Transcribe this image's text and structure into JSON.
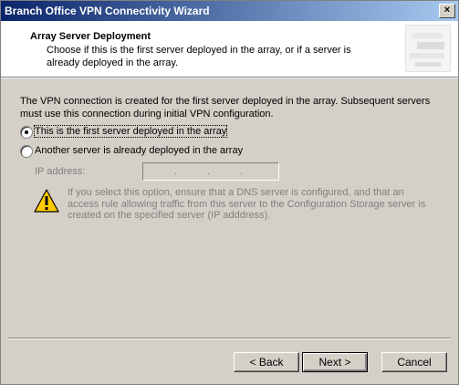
{
  "window": {
    "title": "Branch Office VPN Connectivity Wizard",
    "close_glyph": "×"
  },
  "header": {
    "title": "Array Server Deployment",
    "subtitle": "Choose if this is the first server deployed in the array, or if a server is already deployed in the array."
  },
  "intro": "The VPN connection is created for the first server deployed in the array. Subsequent servers must use this connection during initial VPN configuration.",
  "options": {
    "first": {
      "label": "This is the first server deployed in the array",
      "selected": true
    },
    "another": {
      "label": "Another server is already deployed in the array",
      "selected": false
    }
  },
  "ip": {
    "label": "IP address:",
    "value": ". . ."
  },
  "warning": {
    "icon": "warning-icon",
    "text": "If you select this option, ensure that a DNS server is configured, and that an access rule allowing traffic from this server to the Configuration Storage server is created on the specified server (IP adddress)."
  },
  "buttons": {
    "back": "< Back",
    "next": "Next >",
    "cancel": "Cancel"
  },
  "colors": {
    "titlebar_start": "#0a246a",
    "titlebar_end": "#a6caf0",
    "dialog_bg": "#d4d0c8",
    "warning_yellow": "#ffcc00"
  }
}
